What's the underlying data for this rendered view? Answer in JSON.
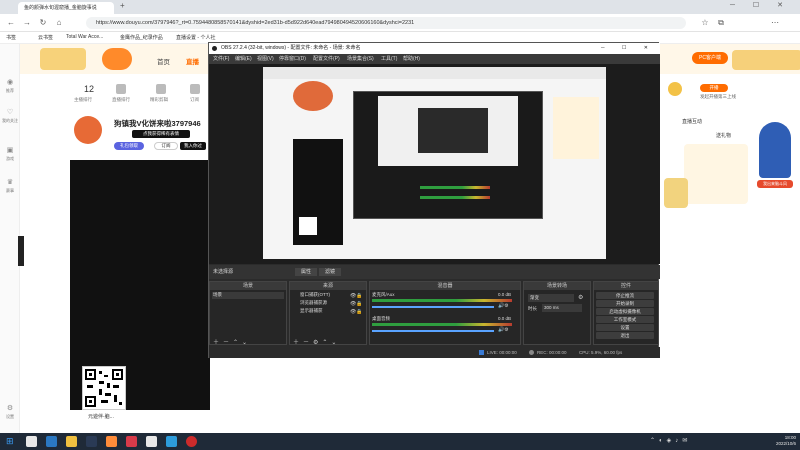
{
  "browser": {
    "tabs": [
      {
        "label": "鱼的颜弹水旬渥窟播_金脑旋事说"
      },
      {
        "label": "+"
      }
    ],
    "url": "https://www.douyu.com/3797946?_rt=0.7594480858570141&dyshid=2ed31b-d5d922d640ead794980494520606160&dyshci=2231",
    "bookmarks": [
      "书签",
      "云书签",
      "Total War Acce...",
      "金鹰作品_纪录作品",
      "直播设置 - 个人社"
    ]
  },
  "site": {
    "nav": [
      "首页",
      "直播",
      "分类",
      "游戏",
      "赛事",
      "视频"
    ],
    "nav_active_index": 1,
    "rail": [
      "推荐",
      "我的关注",
      "游戏",
      "赛事",
      "设置"
    ],
    "stats": [
      {
        "value": "12",
        "label": "主播排行"
      },
      {
        "value": "",
        "label": "直播排行"
      },
      {
        "value": "",
        "label": "精彩剪辑"
      },
      {
        "value": "",
        "label": "订阅"
      }
    ],
    "streamer_title": "狗镇我V化饼来啦3797946",
    "streamer_tags": [
      "点我获得稀有表情",
      "礼包领取",
      "订阅",
      "我入你过"
    ],
    "qr_caption": "元遊伴-脑...",
    "right_buttons": [
      "PC客户端",
      "开播",
      "发起开播第三上线"
    ],
    "right_tabs": [
      "直播互动",
      "送礼物"
    ],
    "side_ad_caption": "我出来脑斗风"
  },
  "obs": {
    "title": "OBS 27.2.4 (32-bit, windows) - 配置文件: 未命名 - 场景: 未命名",
    "menu": [
      "文件(F)",
      "编辑(E)",
      "视图(V)",
      "停靠窗口(D)",
      "配置文件(P)",
      "场景集合(S)",
      "工具(T)",
      "帮助(H)"
    ],
    "status_source": "未选择源",
    "status_buttons": [
      "属性",
      "滤镜"
    ],
    "docks": {
      "scenes": {
        "title": "场景",
        "items": [
          "场景"
        ]
      },
      "sources": {
        "title": "来源",
        "items": [
          "窗口捕获(OTT)",
          "浏览器捕获源",
          "显示器捕获"
        ]
      },
      "mixer": {
        "title": "混音器",
        "channels": [
          {
            "name": "桌面音频",
            "db": "0.0 dB"
          },
          {
            "name": "麦克风/Aux",
            "db": "0.0 dB"
          }
        ]
      },
      "transitions": {
        "title": "场景转场",
        "type": "渐变",
        "duration_label": "时长",
        "duration": "300 ms"
      },
      "controls": {
        "title": "控件",
        "buttons": [
          "停止推流",
          "开始录制",
          "启动虚拟摄像机",
          "工作室模式",
          "设置",
          "退出"
        ]
      }
    },
    "bottom_status": {
      "live": "LIVE: 00:00:00",
      "rec": "REC: 00:00:00",
      "cpu": "CPU: 5.9%, 60.00 fps"
    }
  },
  "taskbar": {
    "time": "18:00",
    "date": "2022/10/6",
    "app_colors": [
      "#e8e8e8",
      "#2b78c2",
      "#f0c040",
      "#2a3a55",
      "#ff8c3a",
      "#d83b4a",
      "#e8e8e8",
      "#2d9cdb",
      "#cc2b2b"
    ]
  },
  "colors": {
    "accent": "#ff6c00",
    "obs_bg": "#2b2b2b",
    "meter_green": "#2f9e3f"
  }
}
